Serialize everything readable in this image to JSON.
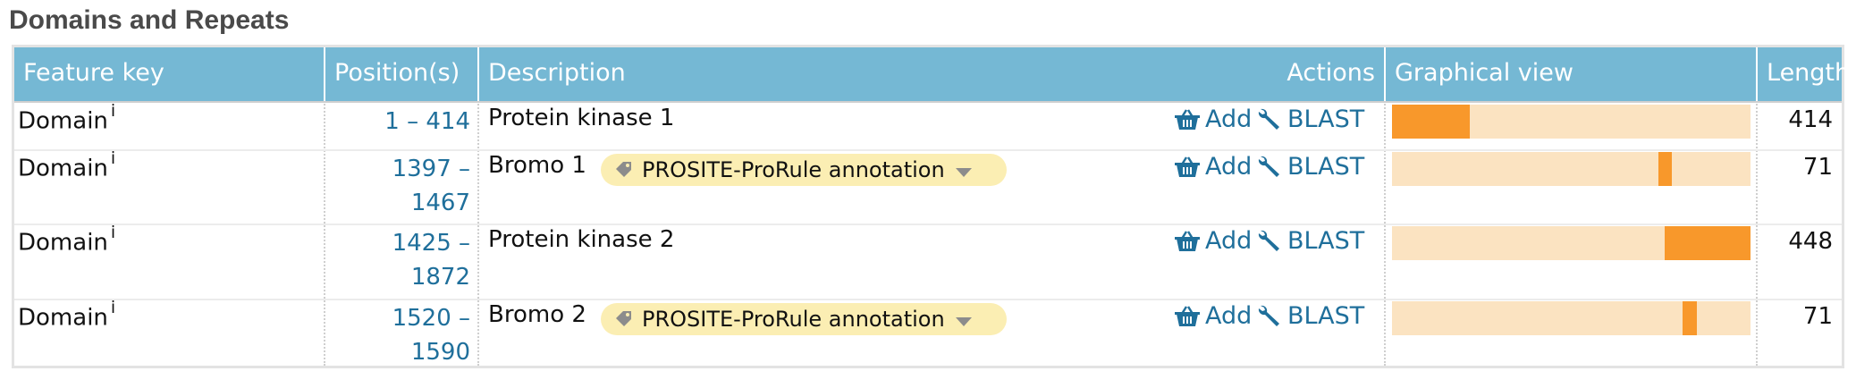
{
  "section": {
    "title": "Domains and Repeats"
  },
  "table": {
    "headers": {
      "feature_key": "Feature key",
      "positions": "Position(s)",
      "description": "Description",
      "actions": "Actions",
      "graphical_view": "Graphical view",
      "length": "Length"
    },
    "info_marker": "i",
    "add_label": "Add",
    "blast_label": "BLAST",
    "pill_label": "PROSITE-ProRule annotation",
    "rows": [
      {
        "feature": "Domain",
        "pos_line1": "1 – 414",
        "pos_line2": "",
        "description": "Protein kinase 1",
        "has_pill": false,
        "length": "414",
        "start_frac": 0.0,
        "end_frac": 0.218
      },
      {
        "feature": "Domain",
        "pos_line1": "1397 –",
        "pos_line2": "1467",
        "description": "Bromo 1",
        "has_pill": true,
        "length": "71",
        "start_frac": 0.744,
        "end_frac": 0.781
      },
      {
        "feature": "Domain",
        "pos_line1": "1425 –",
        "pos_line2": "1872",
        "description": "Protein kinase 2",
        "has_pill": false,
        "length": "448",
        "start_frac": 0.76,
        "end_frac": 1.0
      },
      {
        "feature": "Domain",
        "pos_line1": "1520 –",
        "pos_line2": "1590",
        "description": "Bromo 2",
        "has_pill": true,
        "length": "71",
        "start_frac": 0.81,
        "end_frac": 0.849
      }
    ]
  },
  "colors": {
    "header_bg": "#75b8d4",
    "link": "#1f6f9b",
    "track": "#fbe3c1",
    "fill": "#f8982b",
    "pill": "#fbeeb3"
  }
}
